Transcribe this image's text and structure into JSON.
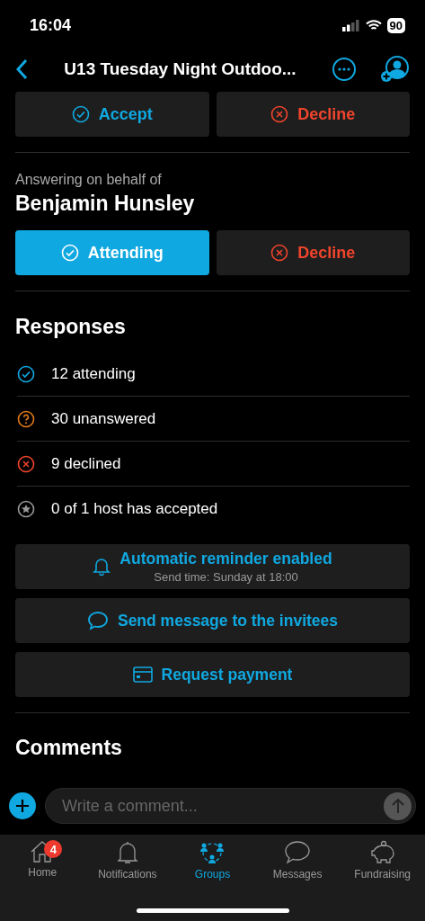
{
  "status_bar": {
    "time": "16:04",
    "battery": "90"
  },
  "nav": {
    "title": "U13 Tuesday Night Outdoo..."
  },
  "own_answer": [
    {
      "kind": "accept",
      "label": "Accept",
      "selected": false
    },
    {
      "kind": "decline",
      "label": "Decline",
      "selected": false
    }
  ],
  "on_behalf": {
    "caption": "Answering on behalf of",
    "name": "Benjamin Hunsley",
    "buttons": [
      {
        "kind": "accept",
        "label": "Attending",
        "selected": true
      },
      {
        "kind": "decline",
        "label": "Decline",
        "selected": false
      }
    ]
  },
  "responses": {
    "title": "Responses",
    "rows": [
      {
        "kind": "attending",
        "label": "12 attending"
      },
      {
        "kind": "unanswered",
        "label": "30 unanswered"
      },
      {
        "kind": "declined",
        "label": "9 declined"
      },
      {
        "kind": "host",
        "label": "0 of 1 host has accepted"
      }
    ]
  },
  "actions": [
    {
      "kind": "reminder",
      "label": "Automatic reminder enabled",
      "subtitle": "Send time: Sunday at 18:00"
    },
    {
      "kind": "message",
      "label": "Send message to the invitees"
    },
    {
      "kind": "payment",
      "label": "Request payment"
    }
  ],
  "comments": {
    "title": "Comments",
    "placeholder": "Write a comment..."
  },
  "tab_bar": [
    {
      "kind": "home",
      "label": "Home",
      "badge": "4",
      "selected": false
    },
    {
      "kind": "notifications",
      "label": "Notifications",
      "selected": false
    },
    {
      "kind": "groups",
      "label": "Groups",
      "selected": true
    },
    {
      "kind": "messages",
      "label": "Messages",
      "selected": false
    },
    {
      "kind": "fundraising",
      "label": "Fundraising",
      "selected": false
    }
  ]
}
